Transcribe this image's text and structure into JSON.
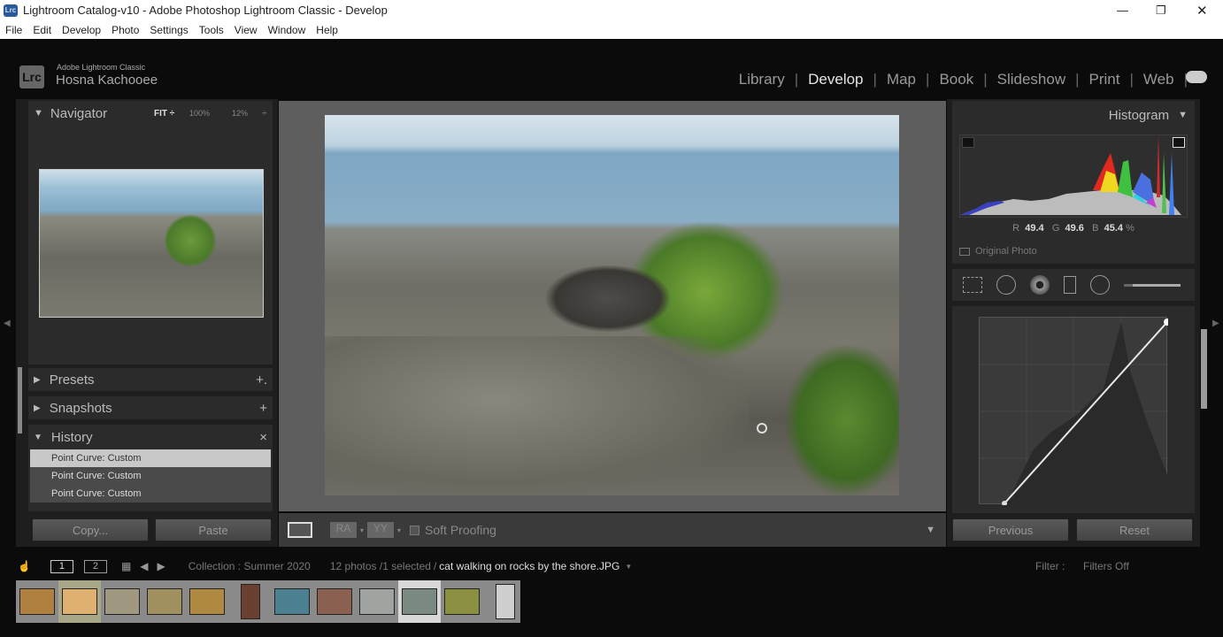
{
  "window": {
    "title": "Lightroom Catalog-v10 - Adobe Photoshop Lightroom Classic - Develop",
    "app_icon": "Lrc"
  },
  "menu": [
    "File",
    "Edit",
    "Develop",
    "Photo",
    "Settings",
    "Tools",
    "View",
    "Window",
    "Help"
  ],
  "identity": {
    "logo": "Lrc",
    "product": "Adobe Lightroom Classic",
    "user": "Hosna Kachooee"
  },
  "modules": [
    {
      "label": "Library"
    },
    {
      "label": "Develop",
      "active": true
    },
    {
      "label": "Map"
    },
    {
      "label": "Book"
    },
    {
      "label": "Slideshow"
    },
    {
      "label": "Print"
    },
    {
      "label": "Web"
    }
  ],
  "navigator": {
    "title": "Navigator",
    "fit": "FIT ÷",
    "zoom1": "100%",
    "zoom2": "12%",
    "spin": "÷"
  },
  "left_panels": {
    "presets": "Presets",
    "presets_action": "+.",
    "snapshots": "Snapshots",
    "snapshots_action": "+",
    "history": "History",
    "history_action": "×"
  },
  "history": [
    "Point Curve: Custom",
    "Point Curve: Custom",
    "Point Curve: Custom"
  ],
  "left_buttons": {
    "copy": "Copy...",
    "paste": "Paste"
  },
  "toolbar": {
    "soft_proofing": "Soft Proofing",
    "soft_proofing_checked": false,
    "before_after": "RA",
    "before_after2": "YY"
  },
  "histogram": {
    "title": "Histogram",
    "r_label": "R",
    "r": "49.4",
    "g_label": "G",
    "g": "49.6",
    "b_label": "B",
    "b": "45.4",
    "unit": "%",
    "original_photo": "Original Photo"
  },
  "right_buttons": {
    "previous": "Previous",
    "reset": "Reset"
  },
  "filmstrip": {
    "collection": "Collection : Summer 2020",
    "count": "12 photos /1 selected",
    "sep": "/",
    "filename": "cat walking on rocks by the shore.JPG",
    "filter_label": "Filter :",
    "filter_value": "Filters Off",
    "page1": "1",
    "page2": "2",
    "thumbs": [
      "#b08040",
      "#e0b070",
      "#a09880",
      "#a09060",
      "#b08a40",
      "#6a4030",
      "#4a8090",
      "#8a6050",
      "#a0a4a0",
      "#7a8a80",
      "#8a9040",
      "#cfcfcf"
    ],
    "selected_index": 9
  },
  "colors": {
    "accent": "#e6e6e6",
    "panel": "#2b2b2b",
    "bg": "#0b0b0b"
  }
}
